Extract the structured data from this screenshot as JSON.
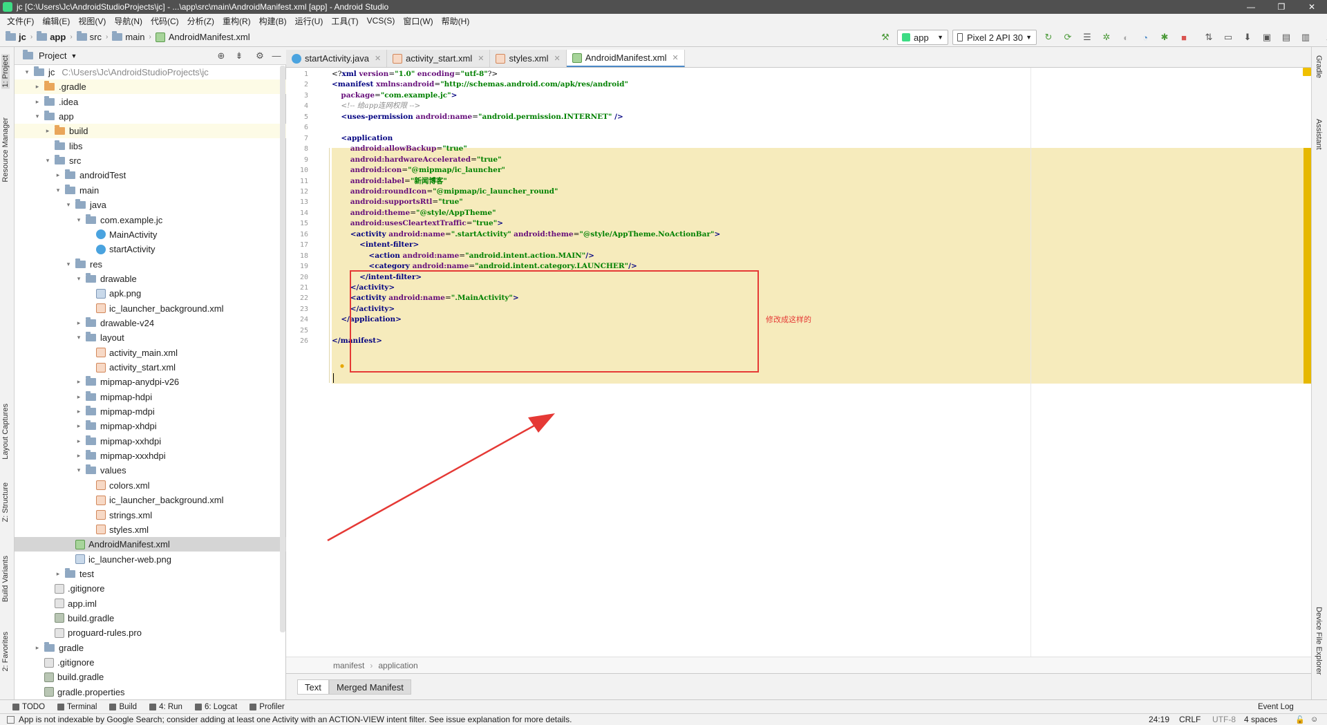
{
  "window": {
    "title": "jc [C:\\Users\\Jc\\AndroidStudioProjects\\jc] - ...\\app\\src\\main\\AndroidManifest.xml [app] - Android Studio"
  },
  "menu": [
    "文件(F)",
    "编辑(E)",
    "视图(V)",
    "导航(N)",
    "代码(C)",
    "分析(Z)",
    "重构(R)",
    "构建(B)",
    "运行(U)",
    "工具(T)",
    "VCS(S)",
    "窗口(W)",
    "帮助(H)"
  ],
  "breadcrumb": [
    "jc",
    "app",
    "src",
    "main",
    "AndroidManifest.xml"
  ],
  "toolbar": {
    "run_config": "app",
    "device": "Pixel 2 API 30"
  },
  "project_panel": {
    "title": "Project",
    "tree": [
      {
        "label": "jc",
        "path": "C:\\Users\\Jc\\AndroidStudioProjects\\jc",
        "depth": 0,
        "arrow": "▾",
        "icon": "folder"
      },
      {
        "label": ".gradle",
        "depth": 1,
        "arrow": "▸",
        "icon": "folder-orange",
        "highlight": true
      },
      {
        "label": ".idea",
        "depth": 1,
        "arrow": "▸",
        "icon": "folder"
      },
      {
        "label": "app",
        "depth": 1,
        "arrow": "▾",
        "icon": "folder"
      },
      {
        "label": "build",
        "depth": 2,
        "arrow": "▸",
        "icon": "folder-orange",
        "highlight": true
      },
      {
        "label": "libs",
        "depth": 2,
        "arrow": "",
        "icon": "folder"
      },
      {
        "label": "src",
        "depth": 2,
        "arrow": "▾",
        "icon": "folder"
      },
      {
        "label": "androidTest",
        "depth": 3,
        "arrow": "▸",
        "icon": "folder"
      },
      {
        "label": "main",
        "depth": 3,
        "arrow": "▾",
        "icon": "folder"
      },
      {
        "label": "java",
        "depth": 4,
        "arrow": "▾",
        "icon": "folder"
      },
      {
        "label": "com.example.jc",
        "depth": 5,
        "arrow": "▾",
        "icon": "folder"
      },
      {
        "label": "MainActivity",
        "depth": 6,
        "arrow": "",
        "icon": "java"
      },
      {
        "label": "startActivity",
        "depth": 6,
        "arrow": "",
        "icon": "java"
      },
      {
        "label": "res",
        "depth": 4,
        "arrow": "▾",
        "icon": "folder"
      },
      {
        "label": "drawable",
        "depth": 5,
        "arrow": "▾",
        "icon": "folder"
      },
      {
        "label": "apk.png",
        "depth": 6,
        "arrow": "",
        "icon": "png"
      },
      {
        "label": "ic_launcher_background.xml",
        "depth": 6,
        "arrow": "",
        "icon": "xml"
      },
      {
        "label": "drawable-v24",
        "depth": 5,
        "arrow": "▸",
        "icon": "folder"
      },
      {
        "label": "layout",
        "depth": 5,
        "arrow": "▾",
        "icon": "folder"
      },
      {
        "label": "activity_main.xml",
        "depth": 6,
        "arrow": "",
        "icon": "xml"
      },
      {
        "label": "activity_start.xml",
        "depth": 6,
        "arrow": "",
        "icon": "xml"
      },
      {
        "label": "mipmap-anydpi-v26",
        "depth": 5,
        "arrow": "▸",
        "icon": "folder"
      },
      {
        "label": "mipmap-hdpi",
        "depth": 5,
        "arrow": "▸",
        "icon": "folder"
      },
      {
        "label": "mipmap-mdpi",
        "depth": 5,
        "arrow": "▸",
        "icon": "folder"
      },
      {
        "label": "mipmap-xhdpi",
        "depth": 5,
        "arrow": "▸",
        "icon": "folder"
      },
      {
        "label": "mipmap-xxhdpi",
        "depth": 5,
        "arrow": "▸",
        "icon": "folder"
      },
      {
        "label": "mipmap-xxxhdpi",
        "depth": 5,
        "arrow": "▸",
        "icon": "folder"
      },
      {
        "label": "values",
        "depth": 5,
        "arrow": "▾",
        "icon": "folder"
      },
      {
        "label": "colors.xml",
        "depth": 6,
        "arrow": "",
        "icon": "xml"
      },
      {
        "label": "ic_launcher_background.xml",
        "depth": 6,
        "arrow": "",
        "icon": "xml"
      },
      {
        "label": "strings.xml",
        "depth": 6,
        "arrow": "",
        "icon": "xml"
      },
      {
        "label": "styles.xml",
        "depth": 6,
        "arrow": "",
        "icon": "xml"
      },
      {
        "label": "AndroidManifest.xml",
        "depth": 4,
        "arrow": "",
        "icon": "mf",
        "selected": true
      },
      {
        "label": "ic_launcher-web.png",
        "depth": 4,
        "arrow": "",
        "icon": "png"
      },
      {
        "label": "test",
        "depth": 3,
        "arrow": "▸",
        "icon": "folder"
      },
      {
        "label": ".gitignore",
        "depth": 2,
        "arrow": "",
        "icon": "txt"
      },
      {
        "label": "app.iml",
        "depth": 2,
        "arrow": "",
        "icon": "txt"
      },
      {
        "label": "build.gradle",
        "depth": 2,
        "arrow": "",
        "icon": "gradle"
      },
      {
        "label": "proguard-rules.pro",
        "depth": 2,
        "arrow": "",
        "icon": "txt"
      },
      {
        "label": "gradle",
        "depth": 1,
        "arrow": "▸",
        "icon": "folder"
      },
      {
        "label": ".gitignore",
        "depth": 1,
        "arrow": "",
        "icon": "txt"
      },
      {
        "label": "build.gradle",
        "depth": 1,
        "arrow": "",
        "icon": "gradle"
      },
      {
        "label": "gradle.properties",
        "depth": 1,
        "arrow": "",
        "icon": "gradle"
      }
    ]
  },
  "editor_tabs": [
    {
      "label": "startActivity.java",
      "icon": "java"
    },
    {
      "label": "activity_start.xml",
      "icon": "xml"
    },
    {
      "label": "styles.xml",
      "icon": "xml"
    },
    {
      "label": "AndroidManifest.xml",
      "icon": "mf",
      "active": true
    }
  ],
  "code_lines": [
    [
      [
        "plain",
        "<?"
      ],
      [
        "tag",
        "xml "
      ],
      [
        "attr",
        "version"
      ],
      [
        "plain",
        "="
      ],
      [
        "val",
        "\"1.0\""
      ],
      [
        "plain",
        " "
      ],
      [
        "attr",
        "encoding"
      ],
      [
        "plain",
        "="
      ],
      [
        "val",
        "\"utf-8\""
      ],
      [
        "plain",
        "?>"
      ]
    ],
    [
      [
        "tag",
        "<manifest "
      ],
      [
        "attr",
        "xmlns:android"
      ],
      [
        "plain",
        "="
      ],
      [
        "val",
        "\"http://schemas.android.com/apk/res/android\""
      ]
    ],
    [
      [
        "plain",
        "    "
      ],
      [
        "attr",
        "package"
      ],
      [
        "plain",
        "="
      ],
      [
        "val",
        "\"com.example.jc\""
      ],
      [
        "tag",
        ">"
      ]
    ],
    [
      [
        "plain",
        "    "
      ],
      [
        "cm",
        "<!-- 给app连网权限 -->"
      ]
    ],
    [
      [
        "plain",
        "    "
      ],
      [
        "tag",
        "<uses-permission "
      ],
      [
        "attr",
        "android:name"
      ],
      [
        "plain",
        "="
      ],
      [
        "val",
        "\"android.permission.INTERNET\""
      ],
      [
        "tag",
        " />"
      ]
    ],
    [],
    [
      [
        "plain",
        "    "
      ],
      [
        "tag",
        "<application"
      ]
    ],
    [
      [
        "plain",
        "        "
      ],
      [
        "attr",
        "android:allowBackup"
      ],
      [
        "plain",
        "="
      ],
      [
        "val",
        "\"true\""
      ]
    ],
    [
      [
        "plain",
        "        "
      ],
      [
        "attr",
        "android:hardwareAccelerated"
      ],
      [
        "plain",
        "="
      ],
      [
        "val",
        "\"true\""
      ]
    ],
    [
      [
        "plain",
        "        "
      ],
      [
        "attr",
        "android:icon"
      ],
      [
        "plain",
        "="
      ],
      [
        "val",
        "\"@mipmap/ic_launcher\""
      ]
    ],
    [
      [
        "plain",
        "        "
      ],
      [
        "attr",
        "android:label"
      ],
      [
        "plain",
        "="
      ],
      [
        "val",
        "\"新闻博客\""
      ]
    ],
    [
      [
        "plain",
        "        "
      ],
      [
        "attr",
        "android:roundIcon"
      ],
      [
        "plain",
        "="
      ],
      [
        "val",
        "\"@mipmap/ic_launcher_round\""
      ]
    ],
    [
      [
        "plain",
        "        "
      ],
      [
        "attr",
        "android:supportsRtl"
      ],
      [
        "plain",
        "="
      ],
      [
        "val",
        "\"true\""
      ]
    ],
    [
      [
        "plain",
        "        "
      ],
      [
        "attr",
        "android:theme"
      ],
      [
        "plain",
        "="
      ],
      [
        "val",
        "\"@style/AppTheme\""
      ]
    ],
    [
      [
        "plain",
        "        "
      ],
      [
        "attr",
        "android:usesCleartextTraffic"
      ],
      [
        "plain",
        "="
      ],
      [
        "val",
        "\"true\""
      ],
      [
        "tag",
        ">"
      ]
    ],
    [
      [
        "plain",
        "        "
      ],
      [
        "tag",
        "<activity "
      ],
      [
        "attr",
        "android:name"
      ],
      [
        "plain",
        "="
      ],
      [
        "val",
        "\".startActivity\""
      ],
      [
        "plain",
        " "
      ],
      [
        "attr",
        "android:theme"
      ],
      [
        "plain",
        "="
      ],
      [
        "val",
        "\"@style/AppTheme.NoActionBar\""
      ],
      [
        "tag",
        ">"
      ]
    ],
    [
      [
        "plain",
        "            "
      ],
      [
        "tag",
        "<intent-filter>"
      ]
    ],
    [
      [
        "plain",
        "                "
      ],
      [
        "tag",
        "<action "
      ],
      [
        "attr",
        "android:name"
      ],
      [
        "plain",
        "="
      ],
      [
        "val",
        "\"android.intent.action.MAIN\""
      ],
      [
        "tag",
        "/>"
      ]
    ],
    [
      [
        "plain",
        "                "
      ],
      [
        "tag",
        "<category "
      ],
      [
        "attr",
        "android:name"
      ],
      [
        "plain",
        "="
      ],
      [
        "val",
        "\"android.intent.category.LAUNCHER\""
      ],
      [
        "tag",
        "/>"
      ]
    ],
    [
      [
        "plain",
        "            "
      ],
      [
        "tag",
        "</intent-filter>"
      ]
    ],
    [
      [
        "plain",
        "        "
      ],
      [
        "tag",
        "</activity>"
      ]
    ],
    [
      [
        "plain",
        "        "
      ],
      [
        "tag",
        "<activity "
      ],
      [
        "attr",
        "android:name"
      ],
      [
        "plain",
        "="
      ],
      [
        "val",
        "\".MainActivity\""
      ],
      [
        "tag",
        ">"
      ]
    ],
    [
      [
        "plain",
        "        "
      ],
      [
        "tag",
        "</activity>"
      ]
    ],
    [
      [
        "plain",
        "    "
      ],
      [
        "tag",
        "</application>"
      ]
    ],
    [],
    [
      [
        "tag",
        "</manifest>"
      ]
    ]
  ],
  "annotation_text": "修改成这样的",
  "editor_breadcrumb": [
    "manifest",
    "application"
  ],
  "bottom_editor_tabs": [
    "Text",
    "Merged Manifest"
  ],
  "left_stripe_tabs": [
    "1: Project",
    "Resource Manager",
    "Layout Captures",
    "Z: Structure",
    "Build Variants",
    "2: Favorites"
  ],
  "right_stripe_tabs": [
    "Gradle",
    "Assistant",
    "Device File Explorer"
  ],
  "tool_windows": [
    {
      "label": "TODO"
    },
    {
      "label": "Terminal"
    },
    {
      "label": "Build"
    },
    {
      "label": "4: Run"
    },
    {
      "label": "6: Logcat"
    },
    {
      "label": "Profiler"
    }
  ],
  "event_log": "Event Log",
  "status": {
    "message": "App is not indexable by Google Search; consider adding at least one Activity with an ACTION-VIEW intent filter. See issue explanation for more details.",
    "position": "24:19",
    "line_sep": "CRLF",
    "encoding": "UTF-8",
    "indent": "4 spaces"
  },
  "colors": {
    "tag": "#000080",
    "attr": "#660e7a",
    "value": "#008000",
    "comment": "#8c8c8c",
    "annotation_red": "#e53935",
    "scope_highlight": "#f6ebbc"
  }
}
